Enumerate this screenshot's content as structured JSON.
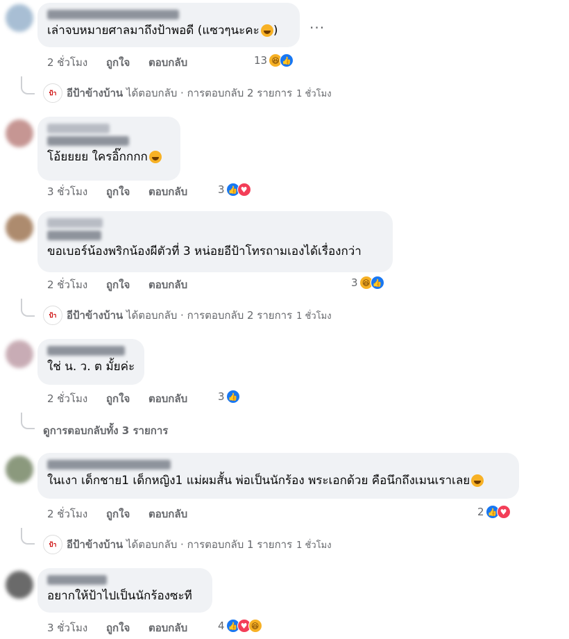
{
  "labels": {
    "like": "ถูกใจ",
    "reply": "ตอบกลับ",
    "more": "..."
  },
  "comments": [
    {
      "text": "เล่าจบหมายศาลมาถึงป้าพอดี (แซวๆนะคะ",
      "time": "2 ชั่วโมง",
      "reaction_count": "13",
      "reactions": [
        "haha-icon",
        "like-icon"
      ],
      "reply_summary": {
        "name": "อีป้าข้างบ้าน",
        "action": "ได้ตอบกลับ · การตอบกลับ 2 รายการ",
        "time": "1 ชั่วโมง"
      }
    },
    {
      "text": "โอ้ยยยย ใครอิ๊กกกก",
      "time": "3 ชั่วโมง",
      "reaction_count": "3",
      "reactions": [
        "like-icon",
        "love-icon"
      ]
    },
    {
      "text": "ขอเบอร์น้องพริกน้องผีตัวที่ 3 หน่อยอีป้าโทรถามเองได้เรื่องกว่า",
      "time": "2 ชั่วโมง",
      "reaction_count": "3",
      "reactions": [
        "haha-icon",
        "like-icon"
      ],
      "reply_summary": {
        "name": "อีป้าข้างบ้าน",
        "action": "ได้ตอบกลับ · การตอบกลับ 2 รายการ",
        "time": "1 ชั่วโมง"
      }
    },
    {
      "text": "ใช่ น. ว. ต มั้ยค่ะ",
      "time": "2 ชั่วโมง",
      "reaction_count": "3",
      "reactions": [
        "like-icon"
      ],
      "view_replies": "ดูการตอบกลับทั้ง 3 รายการ"
    },
    {
      "text": "ในเงา เด็กชาย1 เด็กหญิง1 แม่ผมสั้น พ่อเป็นนักร้อง พระเอกด้วย คือนึกถึงเมนเราเลย",
      "time": "2 ชั่วโมง",
      "reaction_count": "2",
      "reactions": [
        "like-icon",
        "love-icon"
      ],
      "reply_summary": {
        "name": "อีป้าข้างบ้าน",
        "action": "ได้ตอบกลับ · การตอบกลับ 1 รายการ",
        "time": "1 ชั่วโมง"
      }
    },
    {
      "text": "อยากให้ป้าไปเป็นนักร้องซะที",
      "time": "3 ชั่วโมง",
      "reaction_count": "4",
      "reactions": [
        "like-icon",
        "love-icon",
        "haha-icon"
      ]
    }
  ]
}
